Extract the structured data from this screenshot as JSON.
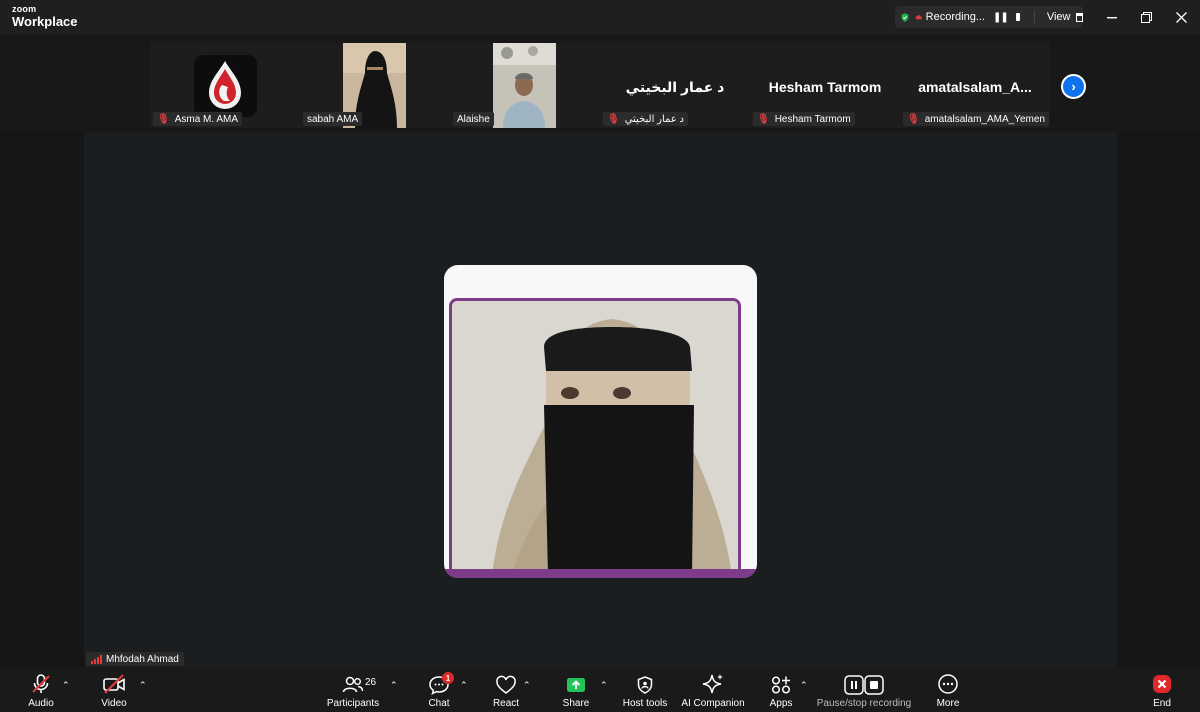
{
  "app": {
    "brand_small": "zoom",
    "brand_big": "Workplace"
  },
  "recording": {
    "status": "Recording...",
    "view_label": "View"
  },
  "gallery": {
    "tiles": [
      {
        "name": "Asma M. AMA",
        "display": "logo",
        "muted": true
      },
      {
        "name": "sabah AMA",
        "display": "video",
        "muted": false
      },
      {
        "name": "Alaishe",
        "display": "video",
        "muted": false
      },
      {
        "name": "د عمار البخيتي",
        "display": "د عمار البخيتي",
        "muted": true
      },
      {
        "name": "Hesham Tarmom",
        "display": "Hesham Tarmom",
        "muted": true
      },
      {
        "name": "amatalsalam_AMA_Yemen",
        "display": "amatalsalam_A...",
        "muted": true
      }
    ]
  },
  "speaker": {
    "name": "Mhfodah Ahmad"
  },
  "toolbar": {
    "audio": "Audio",
    "video": "Video",
    "participants": "Participants",
    "participants_count": "26",
    "chat": "Chat",
    "chat_badge": "1",
    "react": "React",
    "share": "Share",
    "host_tools": "Host tools",
    "ai_companion": "AI Companion",
    "apps": "Apps",
    "pause_stop_recording": "Pause/stop recording",
    "more": "More",
    "end": "End"
  },
  "colors": {
    "accent_blue": "#0e72ed",
    "share_green": "#23c25a",
    "mute_red": "#e23b3b",
    "frame_purple": "#7d3b8a",
    "shield_green": "#23b14d"
  }
}
